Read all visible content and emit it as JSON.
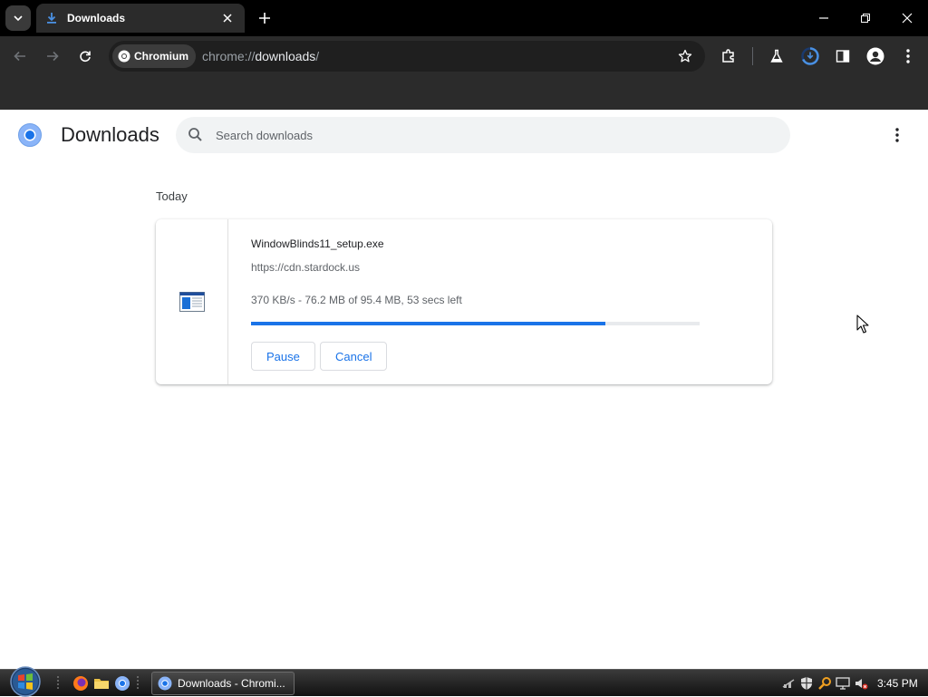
{
  "browser": {
    "tab": {
      "title": "Downloads"
    },
    "omnibox": {
      "chip_label": "Chromium",
      "url_scheme": "chrome://",
      "url_host": "downloads",
      "url_path": "/"
    }
  },
  "page": {
    "title": "Downloads",
    "search": {
      "placeholder": "Search downloads",
      "value": ""
    },
    "date_heading": "Today",
    "downloads": [
      {
        "file_name": "WindowBlinds11_setup.exe",
        "url": "https://cdn.stardock.us",
        "status": "370 KB/s - 76.2 MB of 95.4 MB, 53 secs left",
        "progress_percent": 79,
        "pause_label": "Pause",
        "cancel_label": "Cancel"
      }
    ]
  },
  "taskbar": {
    "active_window_label": "Downloads - Chromi...",
    "clock": "3:45 PM"
  },
  "icons": {
    "tab_favicon": "download-icon",
    "chip": "chromium-logo-icon",
    "page_logo": "chromium-logo-icon",
    "file": "exe-file-icon"
  },
  "colors": {
    "accent": "#1a73e8",
    "chrome_dark": "#2b2b2b",
    "titlebar": "#000000"
  }
}
